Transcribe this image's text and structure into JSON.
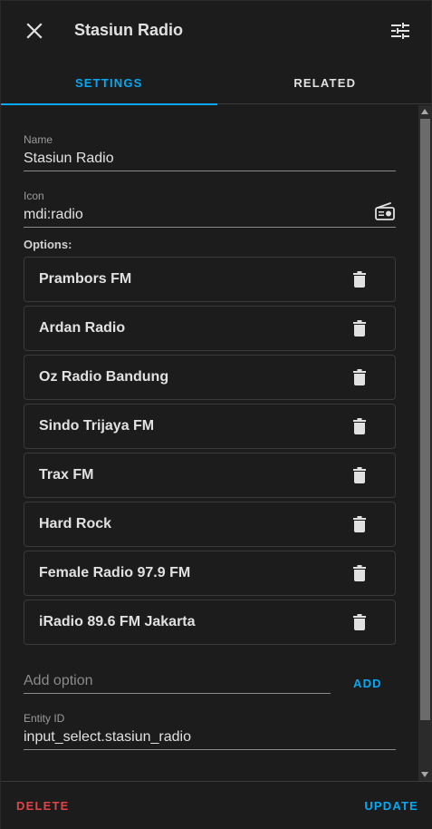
{
  "header": {
    "title": "Stasiun Radio"
  },
  "tabs": [
    {
      "label": "SETTINGS"
    },
    {
      "label": "RELATED"
    }
  ],
  "form": {
    "name_label": "Name",
    "name_value": "Stasiun Radio",
    "icon_label": "Icon",
    "icon_value": "mdi:radio",
    "options_label": "Options:",
    "options": [
      {
        "label": "Prambors FM"
      },
      {
        "label": "Ardan Radio"
      },
      {
        "label": "Oz Radio Bandung"
      },
      {
        "label": "Sindo Trijaya FM"
      },
      {
        "label": "Trax FM"
      },
      {
        "label": "Hard Rock"
      },
      {
        "label": "Female Radio 97.9 FM"
      },
      {
        "label": "iRadio 89.6 FM Jakarta"
      }
    ],
    "add_placeholder": "Add option",
    "add_label": "ADD",
    "entity_label": "Entity ID",
    "entity_value": "input_select.stasiun_radio"
  },
  "footer": {
    "delete_label": "DELETE",
    "update_label": "UPDATE"
  },
  "colors": {
    "accent": "#03a9f4",
    "danger": "#e04545",
    "background": "#1c1c1c"
  }
}
